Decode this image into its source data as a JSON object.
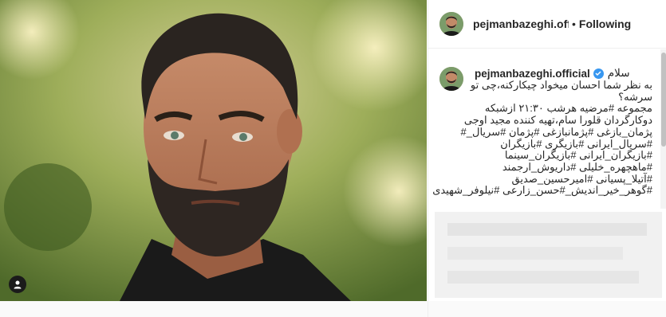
{
  "header": {
    "username": "pejmanbazeghi.official",
    "separator": "•",
    "follow_label": "Following"
  },
  "caption": {
    "username": "pejmanbazeghi.official",
    "first_line": "سلام",
    "lines": [
      "به نظر شما احسان میخواد چیکارکنه،چی تو",
      "سرشه؟",
      "مجموعه #مرضیه هرشب ۲۱:۳۰ ازشبکه",
      "دوکارگردان قلورا سام،تهیه کننده مجید اوجی",
      "پژمان_بازغی #پژمانبازغی #پژمان #سریال_#",
      "#سریال_ایرانی #بازیگری #بازیگران",
      "#بازیگران_ایرانی #بازیگران_سینما",
      "#ماهچهره_خلیلی #داریوش_ارجمند",
      "#آتیلا_پسیانی #امیرحسین_صدیق",
      "#گوهر_خیر_اندیش_#حسن_زارعی #نیلوفر_شهیدی"
    ]
  },
  "icons": {
    "tag": "user-tag-icon",
    "verified": "verified-badge-icon"
  },
  "colors": {
    "verified": "#3897f0",
    "text": "#262626"
  }
}
